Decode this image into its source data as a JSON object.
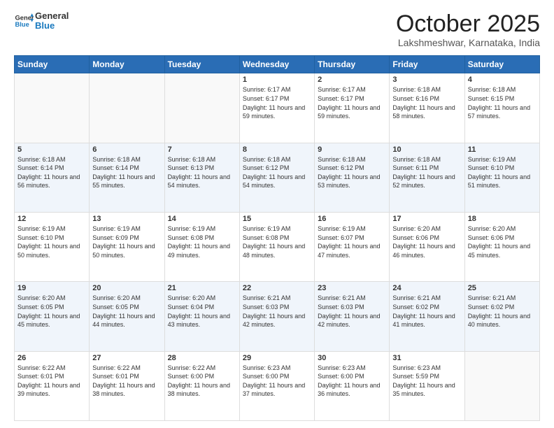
{
  "header": {
    "logo_line1": "General",
    "logo_line2": "Blue",
    "month_title": "October 2025",
    "location": "Lakshmeshwar, Karnataka, India"
  },
  "weekdays": [
    "Sunday",
    "Monday",
    "Tuesday",
    "Wednesday",
    "Thursday",
    "Friday",
    "Saturday"
  ],
  "weeks": [
    [
      {
        "day": "",
        "sunrise": "",
        "sunset": "",
        "daylight": ""
      },
      {
        "day": "",
        "sunrise": "",
        "sunset": "",
        "daylight": ""
      },
      {
        "day": "",
        "sunrise": "",
        "sunset": "",
        "daylight": ""
      },
      {
        "day": "1",
        "sunrise": "Sunrise: 6:17 AM",
        "sunset": "Sunset: 6:17 PM",
        "daylight": "Daylight: 11 hours and 59 minutes."
      },
      {
        "day": "2",
        "sunrise": "Sunrise: 6:17 AM",
        "sunset": "Sunset: 6:17 PM",
        "daylight": "Daylight: 11 hours and 59 minutes."
      },
      {
        "day": "3",
        "sunrise": "Sunrise: 6:18 AM",
        "sunset": "Sunset: 6:16 PM",
        "daylight": "Daylight: 11 hours and 58 minutes."
      },
      {
        "day": "4",
        "sunrise": "Sunrise: 6:18 AM",
        "sunset": "Sunset: 6:15 PM",
        "daylight": "Daylight: 11 hours and 57 minutes."
      }
    ],
    [
      {
        "day": "5",
        "sunrise": "Sunrise: 6:18 AM",
        "sunset": "Sunset: 6:14 PM",
        "daylight": "Daylight: 11 hours and 56 minutes."
      },
      {
        "day": "6",
        "sunrise": "Sunrise: 6:18 AM",
        "sunset": "Sunset: 6:14 PM",
        "daylight": "Daylight: 11 hours and 55 minutes."
      },
      {
        "day": "7",
        "sunrise": "Sunrise: 6:18 AM",
        "sunset": "Sunset: 6:13 PM",
        "daylight": "Daylight: 11 hours and 54 minutes."
      },
      {
        "day": "8",
        "sunrise": "Sunrise: 6:18 AM",
        "sunset": "Sunset: 6:12 PM",
        "daylight": "Daylight: 11 hours and 54 minutes."
      },
      {
        "day": "9",
        "sunrise": "Sunrise: 6:18 AM",
        "sunset": "Sunset: 6:12 PM",
        "daylight": "Daylight: 11 hours and 53 minutes."
      },
      {
        "day": "10",
        "sunrise": "Sunrise: 6:18 AM",
        "sunset": "Sunset: 6:11 PM",
        "daylight": "Daylight: 11 hours and 52 minutes."
      },
      {
        "day": "11",
        "sunrise": "Sunrise: 6:19 AM",
        "sunset": "Sunset: 6:10 PM",
        "daylight": "Daylight: 11 hours and 51 minutes."
      }
    ],
    [
      {
        "day": "12",
        "sunrise": "Sunrise: 6:19 AM",
        "sunset": "Sunset: 6:10 PM",
        "daylight": "Daylight: 11 hours and 50 minutes."
      },
      {
        "day": "13",
        "sunrise": "Sunrise: 6:19 AM",
        "sunset": "Sunset: 6:09 PM",
        "daylight": "Daylight: 11 hours and 50 minutes."
      },
      {
        "day": "14",
        "sunrise": "Sunrise: 6:19 AM",
        "sunset": "Sunset: 6:08 PM",
        "daylight": "Daylight: 11 hours and 49 minutes."
      },
      {
        "day": "15",
        "sunrise": "Sunrise: 6:19 AM",
        "sunset": "Sunset: 6:08 PM",
        "daylight": "Daylight: 11 hours and 48 minutes."
      },
      {
        "day": "16",
        "sunrise": "Sunrise: 6:19 AM",
        "sunset": "Sunset: 6:07 PM",
        "daylight": "Daylight: 11 hours and 47 minutes."
      },
      {
        "day": "17",
        "sunrise": "Sunrise: 6:20 AM",
        "sunset": "Sunset: 6:06 PM",
        "daylight": "Daylight: 11 hours and 46 minutes."
      },
      {
        "day": "18",
        "sunrise": "Sunrise: 6:20 AM",
        "sunset": "Sunset: 6:06 PM",
        "daylight": "Daylight: 11 hours and 45 minutes."
      }
    ],
    [
      {
        "day": "19",
        "sunrise": "Sunrise: 6:20 AM",
        "sunset": "Sunset: 6:05 PM",
        "daylight": "Daylight: 11 hours and 45 minutes."
      },
      {
        "day": "20",
        "sunrise": "Sunrise: 6:20 AM",
        "sunset": "Sunset: 6:05 PM",
        "daylight": "Daylight: 11 hours and 44 minutes."
      },
      {
        "day": "21",
        "sunrise": "Sunrise: 6:20 AM",
        "sunset": "Sunset: 6:04 PM",
        "daylight": "Daylight: 11 hours and 43 minutes."
      },
      {
        "day": "22",
        "sunrise": "Sunrise: 6:21 AM",
        "sunset": "Sunset: 6:03 PM",
        "daylight": "Daylight: 11 hours and 42 minutes."
      },
      {
        "day": "23",
        "sunrise": "Sunrise: 6:21 AM",
        "sunset": "Sunset: 6:03 PM",
        "daylight": "Daylight: 11 hours and 42 minutes."
      },
      {
        "day": "24",
        "sunrise": "Sunrise: 6:21 AM",
        "sunset": "Sunset: 6:02 PM",
        "daylight": "Daylight: 11 hours and 41 minutes."
      },
      {
        "day": "25",
        "sunrise": "Sunrise: 6:21 AM",
        "sunset": "Sunset: 6:02 PM",
        "daylight": "Daylight: 11 hours and 40 minutes."
      }
    ],
    [
      {
        "day": "26",
        "sunrise": "Sunrise: 6:22 AM",
        "sunset": "Sunset: 6:01 PM",
        "daylight": "Daylight: 11 hours and 39 minutes."
      },
      {
        "day": "27",
        "sunrise": "Sunrise: 6:22 AM",
        "sunset": "Sunset: 6:01 PM",
        "daylight": "Daylight: 11 hours and 38 minutes."
      },
      {
        "day": "28",
        "sunrise": "Sunrise: 6:22 AM",
        "sunset": "Sunset: 6:00 PM",
        "daylight": "Daylight: 11 hours and 38 minutes."
      },
      {
        "day": "29",
        "sunrise": "Sunrise: 6:23 AM",
        "sunset": "Sunset: 6:00 PM",
        "daylight": "Daylight: 11 hours and 37 minutes."
      },
      {
        "day": "30",
        "sunrise": "Sunrise: 6:23 AM",
        "sunset": "Sunset: 6:00 PM",
        "daylight": "Daylight: 11 hours and 36 minutes."
      },
      {
        "day": "31",
        "sunrise": "Sunrise: 6:23 AM",
        "sunset": "Sunset: 5:59 PM",
        "daylight": "Daylight: 11 hours and 35 minutes."
      },
      {
        "day": "",
        "sunrise": "",
        "sunset": "",
        "daylight": ""
      }
    ]
  ]
}
